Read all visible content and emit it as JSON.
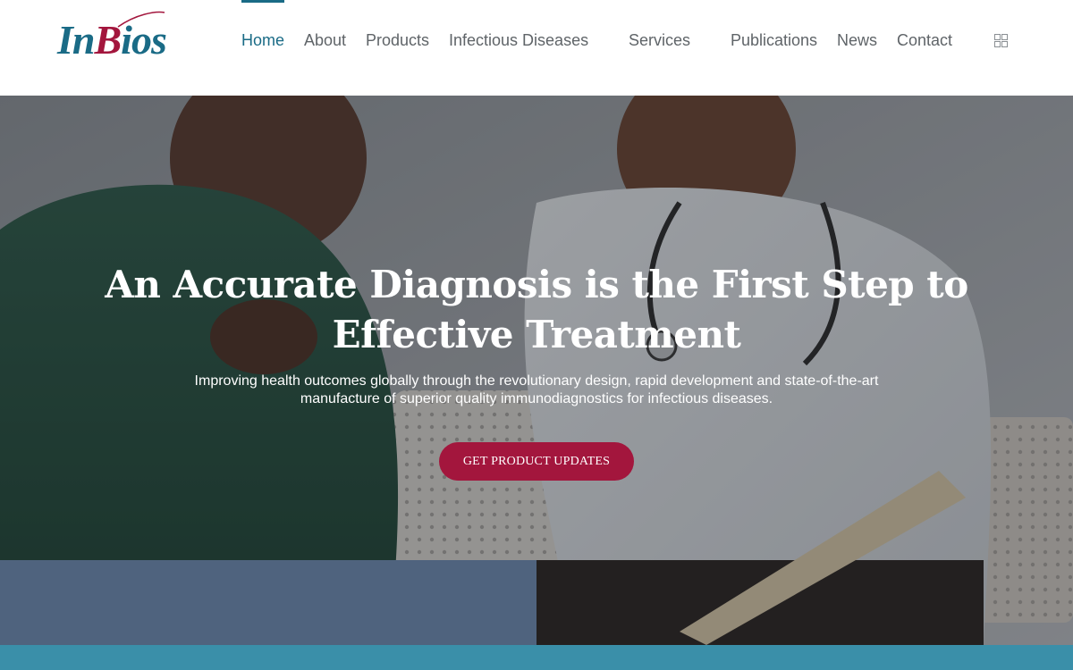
{
  "brand": {
    "logo_text_in": "In",
    "logo_text_b": "B",
    "logo_text_ios": "ios",
    "primary_color": "#1a6b86",
    "accent_color": "#a3163d"
  },
  "nav": {
    "items": [
      {
        "label": "Home",
        "active": true
      },
      {
        "label": "About"
      },
      {
        "label": "Products"
      },
      {
        "label": "Infectious Diseases"
      },
      {
        "label": "Services"
      },
      {
        "label": "Publications"
      },
      {
        "label": "News"
      },
      {
        "label": "Contact"
      }
    ],
    "menu_icon": "grid-icon"
  },
  "hero": {
    "title": "An Accurate Diagnosis is the First Step to Effective Treatment",
    "subtitle": "Improving health outcomes globally through the revolutionary design, rapid development and state-of-the-art manufacture of superior quality immunodiagnostics for infectious diseases.",
    "cta_label": "GET PRODUCT UPDATES",
    "image": "doctor-and-patient-shaking-hands-photo"
  }
}
